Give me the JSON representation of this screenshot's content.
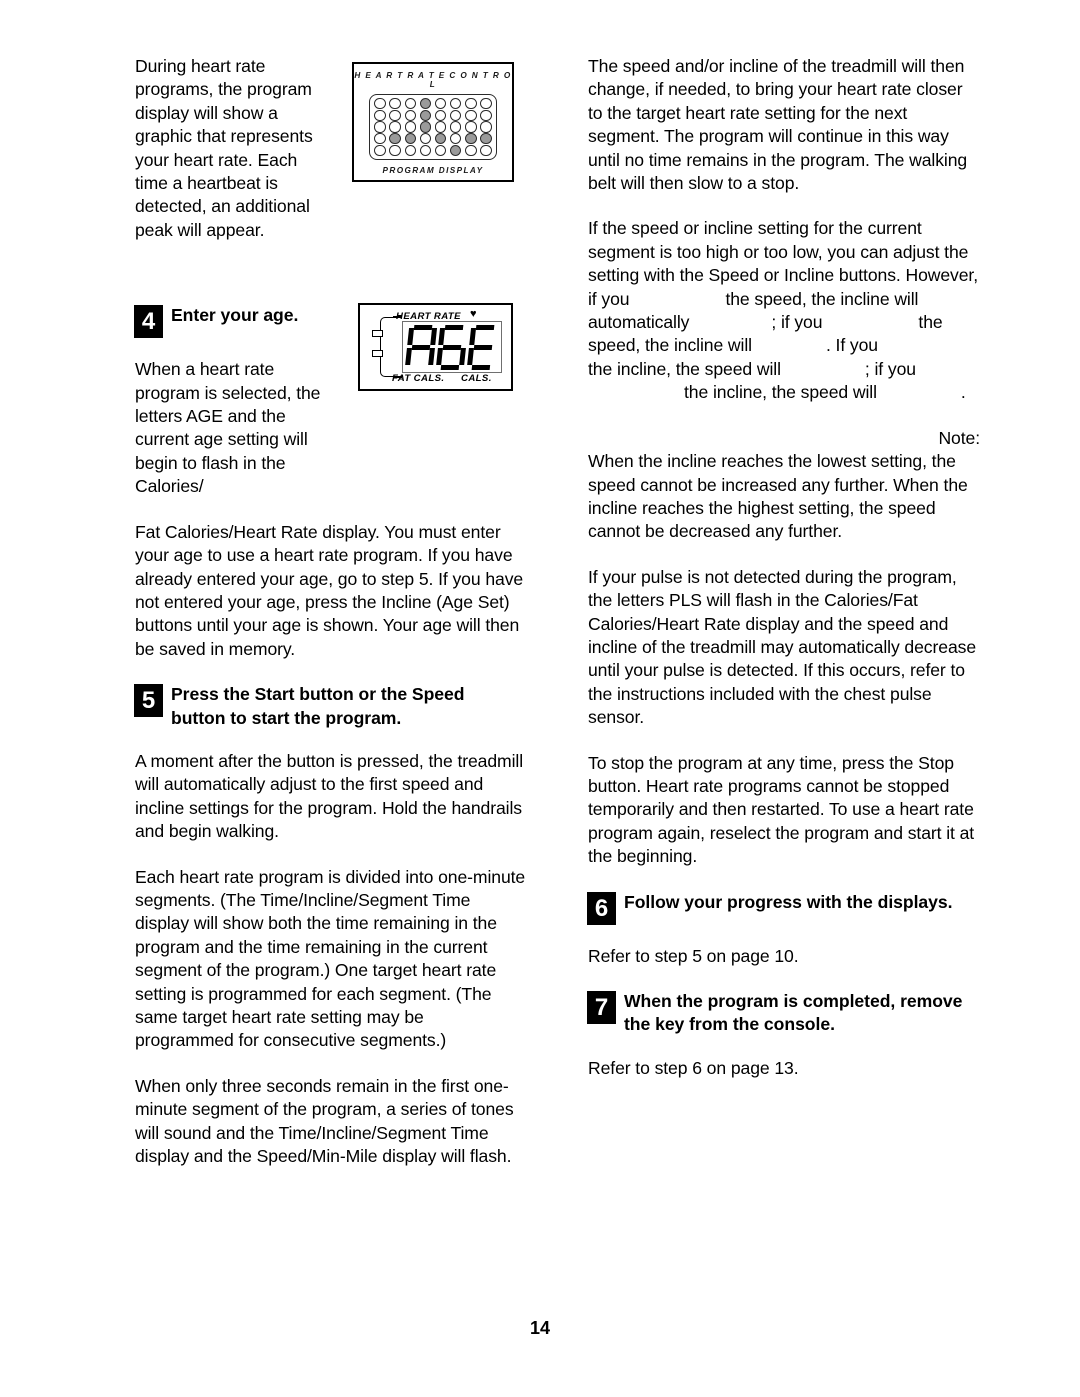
{
  "page": {
    "number": "14"
  },
  "left_column": {
    "intro_paragraph": "During heart rate programs, the program display will show a graphic that represents your heart rate. Each time a heartbeat is detected, an additional peak will appear.",
    "step4": {
      "number": "4",
      "title": "Enter your age.",
      "body_narrow": "When a heart rate program is selected, the letters AGE and the current age setting will begin to flash in the Calories/",
      "body_wide": "Fat Calories/Heart Rate display. You must enter your age to use a heart rate program. If you have already entered your age, go to step 5. If you have not entered your age, press the Incline (Age Set) buttons until your age is shown. Your age will then be saved in memory."
    },
    "step5": {
      "number": "5",
      "title_part1": "Press the Start button or the Speed",
      "title_part2": "button to start the program.",
      "paragraph1": "A moment after the button is pressed, the treadmill will automatically adjust to the first speed and incline settings for the program. Hold the handrails and begin walking.",
      "paragraph2": "Each heart rate program is divided into one-minute segments. (The Time/Incline/Segment Time display will show both the time remaining in the program and the time remaining in the current segment of the program.) One target heart rate setting is programmed for each segment. (The same target heart rate setting may be programmed for consecutive segments.)",
      "paragraph3": "When only three seconds remain in the first one-minute segment of the program, a series of tones will sound and the Time/Incline/Segment Time display and the Speed/Min-Mile display will flash."
    }
  },
  "right_column": {
    "paragraph1": "The speed and/or incline of the treadmill will then change, if needed, to bring your heart rate closer to the target heart rate setting for the next segment. The program will continue in this way until no time remains in the program. The walking belt will then slow to a stop.",
    "adjust_paragraph": {
      "p1": "If the speed or incline setting for the current segment is too high or too low, you can adjust the setting with the Speed or Incline buttons. However, if you",
      "p2": "the speed, the incline will automatically",
      "p3": "; if you",
      "p4": "the speed, the incline will",
      "p5": ". If you",
      "p6": "the incline, the speed will",
      "p7": "; if you",
      "p8": "the incline, the speed will",
      "p9": "."
    },
    "note_label": "Note:",
    "note_body": "When the incline reaches the lowest setting, the speed cannot be increased any further. When the incline reaches the highest setting, the speed cannot be decreased any further.",
    "pulse_paragraph": "If your pulse is not detected during the program, the letters PLS will flash in the Calories/Fat Calories/Heart Rate display and the speed and incline of the treadmill may automatically decrease until your pulse is detected. If this occurs, refer to the instructions included with the chest pulse sensor.",
    "stop_paragraph": "To stop the program at any time, press the Stop button. Heart rate programs cannot be stopped temporarily and then restarted. To use a heart rate program again, reselect the program and start it at the beginning.",
    "step6": {
      "number": "6",
      "title": "Follow your progress with the displays.",
      "body": "Refer to step 5 on page 10."
    },
    "step7": {
      "number": "7",
      "title": "When the program is completed, remove the key from the console.",
      "body": "Refer to step 6 on page 13."
    }
  },
  "figures": {
    "heart_rate_control": {
      "caption_top": "H E A R T   R A T E   C O N T R O L",
      "caption_bottom": "PROGRAM DISPLAY",
      "columns": 8,
      "rows": 5,
      "filled_cells": [
        [
          0,
          0,
          0,
          1,
          0,
          0,
          0,
          0
        ],
        [
          0,
          0,
          0,
          1,
          0,
          0,
          0,
          0
        ],
        [
          0,
          0,
          0,
          1,
          0,
          0,
          0,
          0
        ],
        [
          0,
          1,
          1,
          0,
          1,
          0,
          1,
          1
        ],
        [
          0,
          0,
          0,
          0,
          0,
          1,
          0,
          0
        ]
      ],
      "dot_on_color": "#9a9a9a",
      "dot_off_color": "#ffffff"
    },
    "age_display": {
      "label_heart_rate": "HEART RATE",
      "heart_symbol": "♥",
      "label_fat_cals": "FAT CALS.",
      "label_cals": "CALS.",
      "lcd_text": "AGE",
      "lcd_segments": [
        [
          "a",
          "b",
          "c",
          "e",
          "f",
          "g"
        ],
        [
          "a",
          "c",
          "d",
          "e",
          "f",
          "g"
        ],
        [
          "a",
          "d",
          "e",
          "f",
          "g"
        ]
      ]
    }
  }
}
